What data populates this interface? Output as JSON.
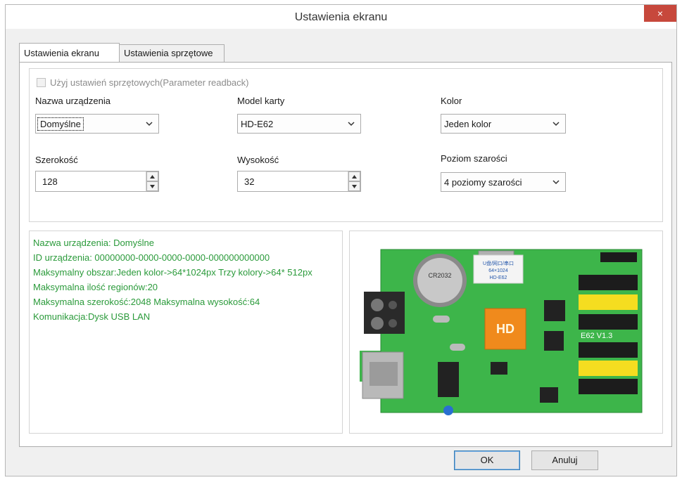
{
  "window": {
    "title": "Ustawienia ekranu",
    "close_icon": "×"
  },
  "tabs": [
    {
      "label": "Ustawienia ekranu",
      "active": true
    },
    {
      "label": "Ustawienia sprzętowe",
      "active": false
    }
  ],
  "settings": {
    "readback_checkbox": {
      "label": "Użyj ustawień sprzętowych(Parameter readback)",
      "checked": false,
      "enabled": false
    },
    "device_name": {
      "label": "Nazwa urządzenia",
      "value": "Domyślne"
    },
    "card_model": {
      "label": "Model karty",
      "value": "HD-E62"
    },
    "color": {
      "label": "Kolor",
      "value": "Jeden kolor"
    },
    "width": {
      "label": "Szerokość",
      "value": "128"
    },
    "height": {
      "label": "Wysokość",
      "value": "32"
    },
    "grayscale": {
      "label": "Poziom szarości",
      "value": "4 poziomy szarości"
    }
  },
  "info": {
    "lines": [
      "Nazwa urządzenia: Domyślne",
      "ID urządzenia:  00000000-0000-0000-0000-000000000000",
      "Maksymalny obszar:Jeden kolor->64*1024px  Trzy kolory->64* 512px",
      "Maksymalna ilość regionów:20",
      "Maksymalna szerokość:2048 Maksymalna wysokość:64",
      "Komunikacja:Dysk USB  LAN"
    ],
    "text_color": "#2a9a3a"
  },
  "board_photo": {
    "labels": {
      "chip": "HD-E62",
      "version": "E62 V1.3",
      "battery": "CR2032",
      "sticker_1": "U盘/网口/串口",
      "sticker_2": "64×1024"
    },
    "pcb_color": "#3db54a"
  },
  "buttons": {
    "ok": "OK",
    "cancel": "Anuluj"
  },
  "colors": {
    "close_button": "#c7483c",
    "default_button_border": "#3c7fb1"
  }
}
